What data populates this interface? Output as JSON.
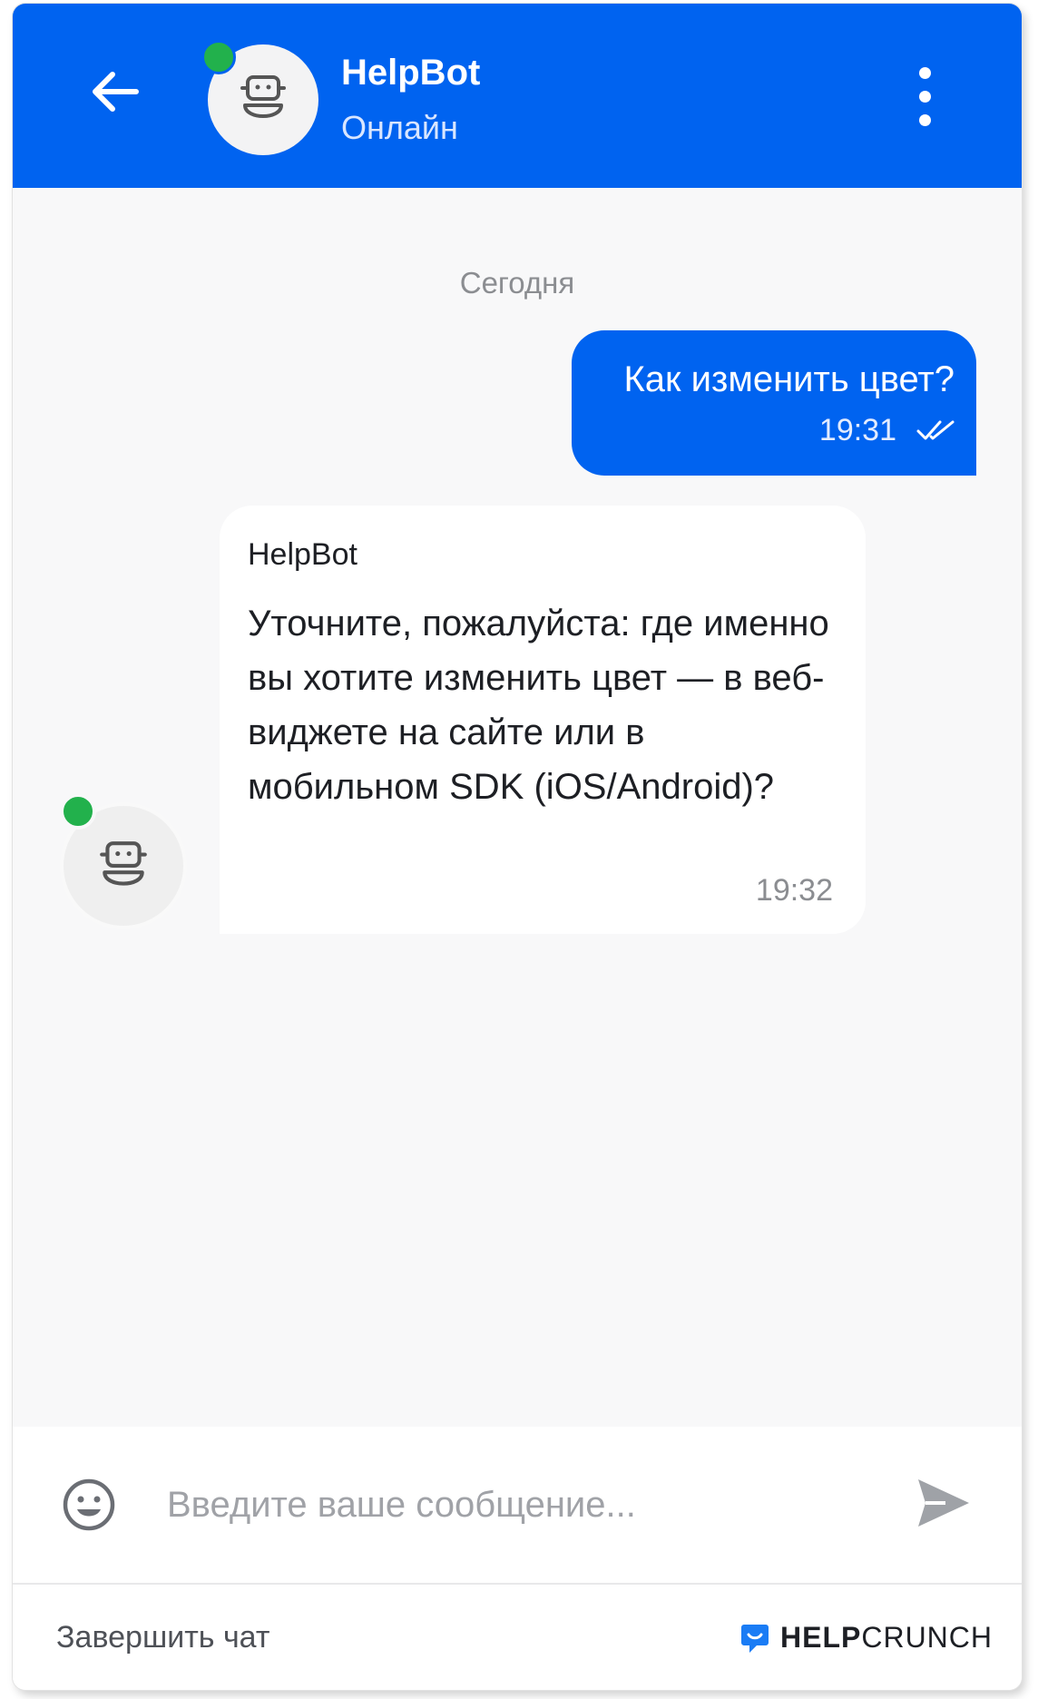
{
  "header": {
    "bot_name": "HelpBot",
    "status": "Онлайн",
    "back_icon": "arrow-left-icon",
    "menu_icon": "more-vertical-icon",
    "background_color": "#0063f0"
  },
  "chat": {
    "date_separator": "Сегодня",
    "messages": [
      {
        "direction": "outgoing",
        "text": "Как изменить цвет?",
        "time": "19:31",
        "status_icon": "double-check-icon"
      },
      {
        "direction": "incoming",
        "sender": "HelpBot",
        "text": "Уточните, пожалуйста: где именно вы хотите изменить цвет — в веб-виджете на сайте или в мобильном SDK (iOS/Android)?",
        "time": "19:32"
      }
    ]
  },
  "composer": {
    "placeholder": "Введите ваше сообщение...",
    "emoji_icon": "smiley-icon",
    "send_icon": "send-icon"
  },
  "footer": {
    "end_chat_label": "Завершить чат",
    "brand_bold": "HELP",
    "brand_regular": "CRUNCH",
    "brand_icon": "chat-bubble-icon"
  },
  "colors": {
    "accent": "#0063f0",
    "online": "#22b14c",
    "chat_background": "#f8f8f9"
  }
}
